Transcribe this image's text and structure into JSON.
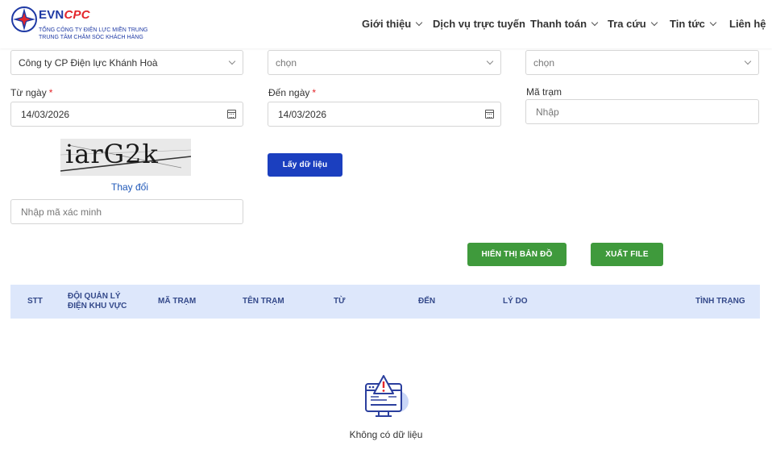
{
  "header": {
    "brand_part1": "EVN",
    "brand_part2": "CPC",
    "company_line1": "TỔNG CÔNG TY ĐIỆN LỰC MIỀN TRUNG",
    "company_line2": "TRUNG TÂM CHĂM SÓC KHÁCH HÀNG",
    "nav": [
      "Giới thiệu",
      "Dịch vụ trực tuyến",
      "Thanh toán",
      "Tra cứu",
      "Tin tức",
      "Liên hệ"
    ]
  },
  "filters": {
    "company_select_value": "Công ty CP Điện lực Khánh Hoà",
    "select2_value": "chọn",
    "select3_value": "chọn",
    "from_label": "Từ ngày",
    "from_value": "14/03/2026",
    "to_label": "Đến ngày",
    "to_value": "14/03/2026",
    "required_mark": "*",
    "station_label": "Mã trạm",
    "station_placeholder": "Nhập",
    "captcha_text": "iarG2k",
    "change_captcha_link": "Thay đổi",
    "captcha_placeholder": "Nhập mã xác minh",
    "fetch_button": "Lấy dữ liệu"
  },
  "actions": {
    "map_button": "HIỂN THỊ BẢN ĐỒ",
    "export_button": "XUẤT FILE"
  },
  "table": {
    "columns": [
      "STT",
      "ĐỘI QUẢN LÝ ĐIỆN KHU VỰC",
      "MÃ TRẠM",
      "TÊN TRẠM",
      "TỪ",
      "ĐẾN",
      "LÝ DO",
      "TÌNH TRẠNG"
    ],
    "empty_text": "Không có dữ liệu"
  },
  "colors": {
    "primary_blue": "#1b3fbf",
    "green": "#3f9a3c",
    "red": "#e3262b",
    "table_head_bg": "#dde7fb"
  }
}
